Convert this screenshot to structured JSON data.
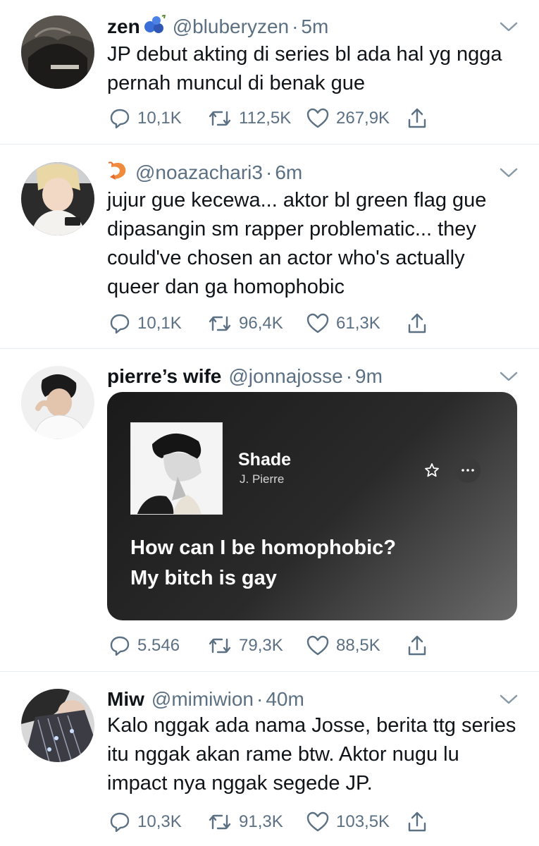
{
  "tweets": [
    {
      "name": "zen",
      "handle": "@bluberyzen",
      "time": "5m",
      "text": "JP debut akting di series bl ada hal yg ngga pernah muncul di benak gue",
      "replies": "10,1K",
      "retweets": "112,5K",
      "likes": "267,9K"
    },
    {
      "name": "",
      "handle": "@noazachari3",
      "time": "6m",
      "text": "jujur gue kecewa... aktor bl green flag gue dipasangin sm rapper problematic... they could've chosen an actor who's actually queer dan ga homophobic",
      "replies": "10,1K",
      "retweets": "96,4K",
      "likes": "61,3K"
    },
    {
      "name": "pierre’s wife",
      "handle": "@jonnajosse",
      "time": "9m",
      "card": {
        "song": "Shade",
        "artist": "J. Pierre",
        "lyric_line1": "How can I be homophobic?",
        "lyric_line2": "My bitch is gay"
      },
      "replies": "5.546",
      "retweets": "79,3K",
      "likes": "88,5K"
    },
    {
      "name": "Miw",
      "handle": "@mimiwion",
      "time": "40m",
      "text": "Kalo nggak ada nama Josse, berita ttg series itu nggak akan rame btw. Aktor nugu lu impact nya nggak segede JP.",
      "replies": "10,3K",
      "retweets": "91,3K",
      "likes": "103,5K"
    }
  ],
  "separator": "·",
  "colors": {
    "text": "#0f1419",
    "secondary": "#5b7083",
    "divider": "#e6ecf0",
    "badge_blue": "#3b6fd8",
    "shrimp": "#f08a3c"
  },
  "icons": [
    "reply-icon",
    "retweet-icon",
    "like-icon",
    "share-icon",
    "chevron-down-icon",
    "star-icon",
    "more-icon"
  ]
}
